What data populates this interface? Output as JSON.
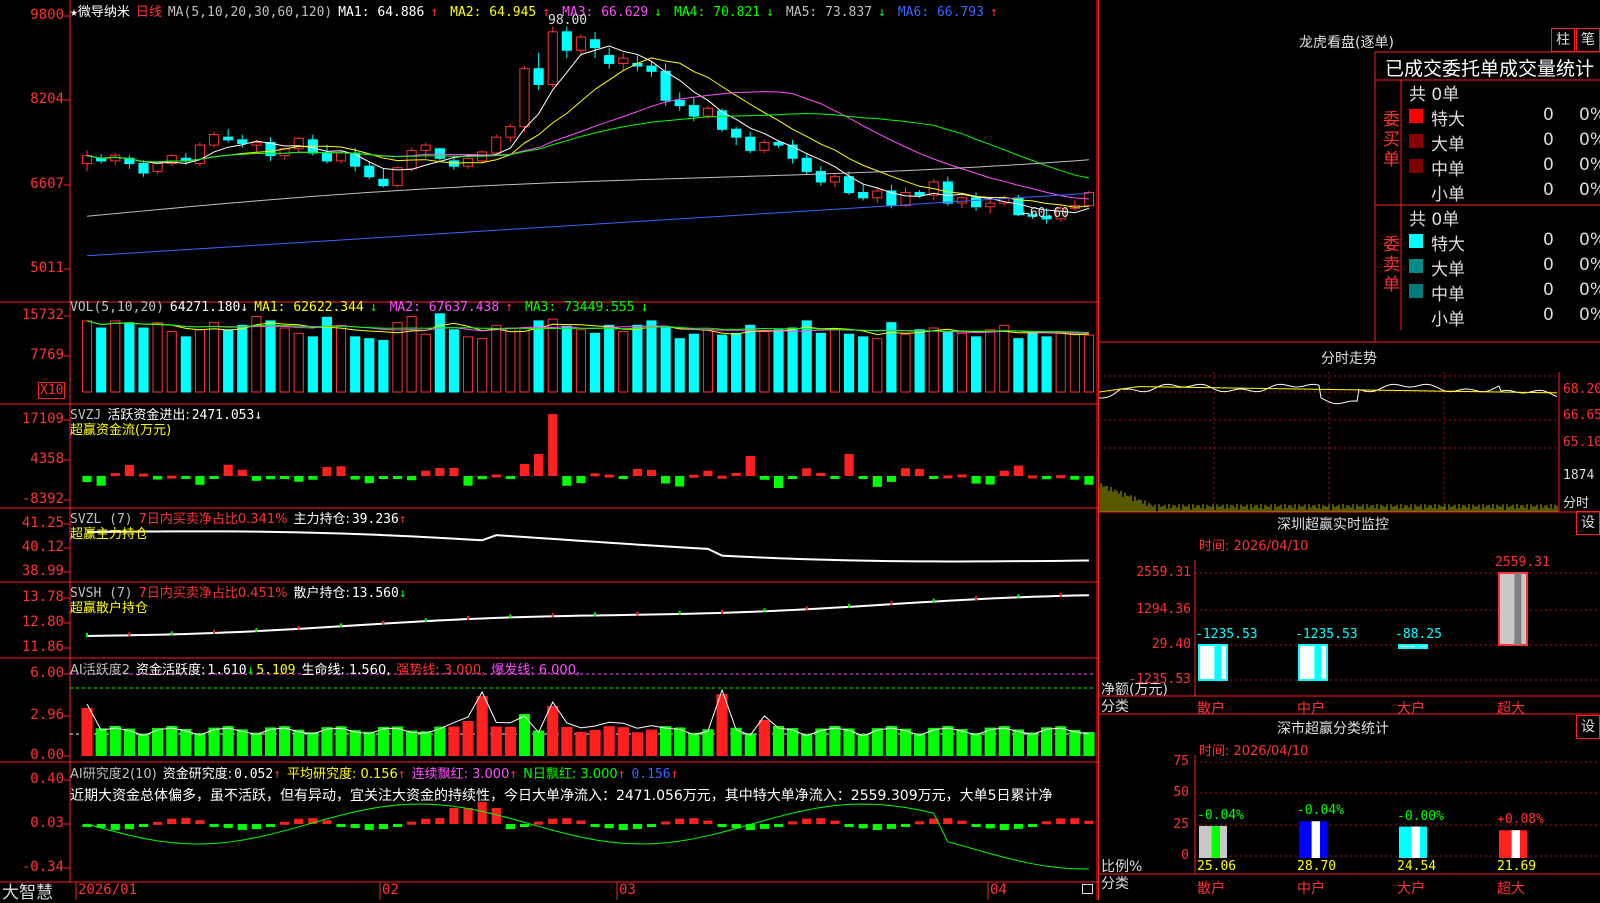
{
  "stock": {
    "name": "微导纳米",
    "period": "日线",
    "star": "★"
  },
  "price_panel": {
    "ma_label": "MA(5,10,20,30,60,120)",
    "ma": [
      {
        "name": "MA1:",
        "value": "64.886",
        "arrow": "↑",
        "color": "#ffffff"
      },
      {
        "name": "MA2:",
        "value": "64.945",
        "arrow": "↑",
        "color": "#ffff00"
      },
      {
        "name": "MA3:",
        "value": "66.629",
        "arrow": "↓",
        "color": "#ff50ff"
      },
      {
        "name": "MA4:",
        "value": "70.821",
        "arrow": "↓",
        "color": "#00ff00"
      },
      {
        "name": "MA5:",
        "value": "73.837",
        "arrow": "↓",
        "color": "#c0c0c0"
      },
      {
        "name": "MA6:",
        "value": "66.793",
        "arrow": "↑",
        "color": "#3c64ff"
      }
    ],
    "yticks": [
      "9800",
      "8204",
      "6607",
      "5011"
    ],
    "high_label": "98.00",
    "low_label": "←60.60"
  },
  "vol_panel": {
    "label": "VOL(5,10,20)",
    "value": "64271.180",
    "arrow": "↓",
    "ma": [
      {
        "name": "MA1:",
        "value": "62622.344",
        "arrow": "↓",
        "color": "#ffff00"
      },
      {
        "name": "MA2:",
        "value": "67637.438",
        "arrow": "↑",
        "color": "#ff50ff"
      },
      {
        "name": "MA3:",
        "value": "73449.555",
        "arrow": "↓",
        "color": "#00ff00"
      }
    ],
    "yticks": [
      "15732",
      "7769"
    ],
    "unit": "X10"
  },
  "svzj": {
    "label": "SVZJ",
    "name": "活跃资金进出:",
    "value": "2471.053",
    "arrow": "↓",
    "sub": "超赢资金流(万元)",
    "yticks": [
      "17109",
      "4358",
      "-8392"
    ]
  },
  "svzl": {
    "label": "SVZL (7)",
    "red_text": "7日内买卖净占比0.341%",
    "name": "主力持仓:",
    "value": "39.236",
    "arrow": "↑",
    "sub": "超赢主力持仓",
    "yticks": [
      "41.25",
      "40.12",
      "38.99"
    ]
  },
  "svsh": {
    "label": "SVSH (7)",
    "red_text": "7日内买卖净占比0.451%",
    "name": "散户持仓:",
    "value": "13.560",
    "arrow": "↓",
    "sub": "超赢散户持仓",
    "yticks": [
      "13.78",
      "12.80",
      "11.86"
    ]
  },
  "ai1": {
    "label": "AI活跃度2",
    "name": "资金活跃度:",
    "value": "1.610",
    "arrow": "↓",
    "v2": "5.109",
    "life": "生命线: 1.560,",
    "strong": "强势线: 3.000,",
    "burst": "爆发线: 6.000,",
    "yticks": [
      "6.00",
      "2.96",
      "0.00"
    ]
  },
  "ai2": {
    "label": "AI研究度2(10)",
    "name": "资金研究度:",
    "value": "0.052",
    "arrow": "↑",
    "avg": "平均研究度: 0.156",
    "avg_arrow": "↑",
    "cont": "连续飘红: 3.000",
    "cont_arrow": "↑",
    "nday": "N日飘红: 3.000",
    "nday_arrow": "↑",
    "last": "0.156",
    "last_arrow": "↑",
    "comment": "近期大资金总体偏多，虽不活跃，但有异动，宜关注大资金的持续性，今日大单净流入：2471.056万元，其中特大单净流入：2559.309万元，大单5日累计净",
    "yticks": [
      "0.40",
      "0.03",
      "-0.34"
    ]
  },
  "xaxis": {
    "labels": [
      "2026/01",
      "02",
      "03",
      "04"
    ]
  },
  "brand": "大智慧",
  "right": {
    "lhb_title": "龙虎看盘(逐单)",
    "btn1": "柱",
    "btn2": "笔",
    "tabs": "已成交委托单成交量统计",
    "buy_title": "委买单",
    "sell_title": "委卖单",
    "buy_total": "共 0单",
    "sell_total": "共 0单",
    "buy_rows": [
      {
        "label": "特大",
        "count": "0",
        "pct": "0%",
        "color": "#ff0000"
      },
      {
        "label": "大单",
        "count": "0",
        "pct": "0%",
        "color": "#8b0000"
      },
      {
        "label": "中单",
        "count": "0",
        "pct": "0%",
        "color": "#7a0000"
      },
      {
        "label": "小单",
        "count": "0",
        "pct": "0%",
        "color": "#000000"
      }
    ],
    "sell_rows": [
      {
        "label": "特大",
        "count": "0",
        "pct": "0%",
        "color": "#00ffff"
      },
      {
        "label": "大单",
        "count": "0",
        "pct": "0%",
        "color": "#008b8b"
      },
      {
        "label": "中单",
        "count": "0",
        "pct": "0%",
        "color": "#007a7a"
      },
      {
        "label": "小单",
        "count": "0",
        "pct": "0%",
        "color": "#000000"
      }
    ],
    "intraday_title": "分时走势",
    "intraday_ticks": [
      "68.20",
      "66.65",
      "65.10",
      "1874"
    ],
    "intraday_unit": "分时",
    "sz_title": "深圳超赢实时监控",
    "sz_btn": "设",
    "sz_time": "时间: 2026/04/10",
    "sz_yticks": [
      "2559.31",
      "1294.36",
      "29.40",
      "-1235.53"
    ],
    "sz_net": "净额(万元)",
    "sz_class": "分类",
    "sz_bars": [
      {
        "cat": "散户",
        "value": -1235.53,
        "label": "-1235.53"
      },
      {
        "cat": "中户",
        "value": -1235.53,
        "label": "-1235.53"
      },
      {
        "cat": "大户",
        "value": -88.25,
        "label": "-88.25"
      },
      {
        "cat": "超大",
        "value": 2559.31,
        "label": "2559.31"
      }
    ],
    "sc_title": "深市超赢分类统计",
    "sc_btn": "设",
    "sc_time": "时间: 2026/04/10",
    "sc_yticks": [
      "75",
      "50",
      "25",
      "0"
    ],
    "sc_ratio": "比例%",
    "sc_class": "分类",
    "sc_bars": [
      {
        "cat": "散户",
        "value": 25.06,
        "label": "25.06",
        "chg": "-0.04%"
      },
      {
        "cat": "中户",
        "value": 28.7,
        "label": "28.70",
        "chg": "-0.04%"
      },
      {
        "cat": "大户",
        "value": 24.54,
        "label": "24.54",
        "chg": "-0.00%"
      },
      {
        "cat": "超大",
        "value": 21.69,
        "label": "21.69",
        "chg": "+0.08%"
      }
    ]
  },
  "chart_data": [
    {
      "type": "candlestick",
      "title": "微导纳米 日线",
      "yticks": [
        "9800",
        "8204",
        "6607",
        "5011"
      ],
      "ohlc": [
        [
          72.0,
          74.5,
          70.5,
          73.5
        ],
        [
          73.0,
          73.8,
          72.0,
          72.5
        ],
        [
          72.5,
          74.0,
          71.8,
          73.6
        ],
        [
          73.0,
          73.5,
          71.0,
          72.0
        ],
        [
          72.0,
          72.6,
          69.5,
          70.2
        ],
        [
          70.5,
          72.5,
          70.0,
          72.0
        ],
        [
          72.0,
          73.8,
          71.5,
          73.5
        ],
        [
          73.0,
          74.0,
          71.8,
          72.5
        ],
        [
          72.0,
          76.0,
          71.5,
          75.5
        ],
        [
          75.5,
          78.0,
          75.0,
          77.5
        ],
        [
          77.0,
          78.5,
          76.0,
          76.5
        ],
        [
          76.5,
          77.5,
          75.0,
          75.8
        ],
        [
          75.5,
          76.5,
          74.0,
          76.0
        ],
        [
          76.0,
          77.0,
          72.5,
          73.5
        ],
        [
          73.5,
          75.0,
          72.8,
          74.8
        ],
        [
          74.8,
          77.0,
          74.0,
          76.8
        ],
        [
          76.5,
          77.5,
          73.5,
          74.0
        ],
        [
          74.0,
          75.5,
          72.0,
          72.5
        ],
        [
          72.5,
          74.5,
          72.0,
          74.0
        ],
        [
          74.0,
          75.0,
          70.5,
          71.5
        ],
        [
          71.5,
          72.5,
          69.0,
          69.5
        ],
        [
          69.0,
          71.0,
          67.5,
          67.8
        ],
        [
          67.8,
          71.5,
          67.5,
          71.2
        ],
        [
          71.0,
          75.0,
          70.5,
          74.5
        ],
        [
          74.5,
          76.0,
          73.0,
          75.5
        ],
        [
          74.8,
          75.0,
          72.5,
          73.0
        ],
        [
          72.5,
          73.5,
          70.8,
          71.5
        ],
        [
          71.5,
          73.5,
          71.0,
          73.0
        ],
        [
          72.5,
          74.5,
          72.0,
          74.2
        ],
        [
          74.0,
          77.5,
          73.8,
          77.0
        ],
        [
          77.0,
          79.5,
          76.0,
          79.0
        ],
        [
          79.0,
          90.5,
          78.0,
          90.0
        ],
        [
          90.0,
          93.0,
          86.0,
          87.0
        ],
        [
          87.0,
          98.0,
          86.5,
          97.0
        ],
        [
          97.0,
          98.0,
          92.0,
          93.5
        ],
        [
          93.5,
          96.5,
          92.5,
          96.0
        ],
        [
          95.5,
          97.0,
          92.0,
          94.0
        ],
        [
          92.5,
          94.0,
          90.0,
          91.0
        ],
        [
          91.0,
          93.0,
          89.5,
          92.0
        ],
        [
          91.0,
          92.5,
          89.5,
          90.5
        ],
        [
          90.5,
          91.5,
          88.5,
          89.5
        ],
        [
          89.5,
          91.0,
          83.0,
          84.0
        ],
        [
          84.0,
          85.5,
          82.0,
          83.0
        ],
        [
          83.0,
          84.5,
          80.0,
          81.0
        ],
        [
          81.0,
          83.0,
          80.5,
          82.5
        ],
        [
          82.0,
          82.5,
          78.0,
          78.5
        ],
        [
          78.5,
          79.0,
          75.5,
          77.0
        ],
        [
          77.0,
          78.0,
          74.0,
          74.5
        ],
        [
          74.5,
          76.5,
          74.0,
          76.0
        ],
        [
          76.0,
          76.5,
          75.0,
          75.5
        ],
        [
          75.5,
          76.5,
          72.0,
          73.0
        ],
        [
          73.0,
          74.0,
          70.0,
          70.5
        ],
        [
          70.5,
          71.5,
          67.8,
          68.5
        ],
        [
          68.5,
          70.0,
          67.5,
          69.5
        ],
        [
          69.5,
          70.5,
          66.0,
          66.5
        ],
        [
          66.5,
          68.0,
          65.0,
          65.5
        ],
        [
          65.5,
          67.5,
          64.5,
          66.8
        ],
        [
          66.8,
          68.0,
          63.5,
          64.0
        ],
        [
          64.0,
          67.5,
          63.8,
          66.5
        ],
        [
          66.5,
          67.0,
          65.5,
          66.0
        ],
        [
          66.0,
          69.0,
          65.0,
          68.5
        ],
        [
          68.5,
          69.5,
          64.0,
          64.5
        ],
        [
          64.5,
          66.0,
          63.5,
          65.5
        ],
        [
          65.5,
          66.5,
          63.0,
          63.8
        ],
        [
          63.8,
          65.0,
          62.5,
          64.5
        ],
        [
          64.5,
          66.0,
          64.0,
          65.5
        ],
        [
          65.5,
          66.0,
          62.0,
          62.3
        ],
        [
          62.3,
          63.0,
          61.5,
          62.0
        ],
        [
          62.0,
          63.5,
          60.6,
          61.5
        ],
        [
          61.5,
          64.0,
          61.0,
          63.5
        ],
        [
          63.5,
          65.0,
          63.0,
          64.0
        ],
        [
          64.0,
          66.8,
          63.8,
          66.5
        ]
      ]
    },
    {
      "type": "bar",
      "title": "VOL(5,10,20)",
      "yticks": [
        "15732",
        "7769"
      ],
      "values": [
        80,
        72,
        80,
        78,
        72,
        78,
        68,
        62,
        70,
        78,
        70,
        75,
        85,
        80,
        72,
        66,
        62,
        84,
        75,
        62,
        60,
        58,
        78,
        85,
        65,
        88,
        70,
        62,
        60,
        75,
        72,
        72,
        80,
        82,
        74,
        70,
        66,
        75,
        68,
        75,
        80,
        72,
        60,
        65,
        70,
        64,
        66,
        75,
        68,
        70,
        72,
        80,
        66,
        70,
        65,
        62,
        60,
        78,
        65,
        70,
        72,
        68,
        66,
        62,
        70,
        75,
        60,
        66,
        62,
        68,
        66,
        64
      ]
    }
  ]
}
